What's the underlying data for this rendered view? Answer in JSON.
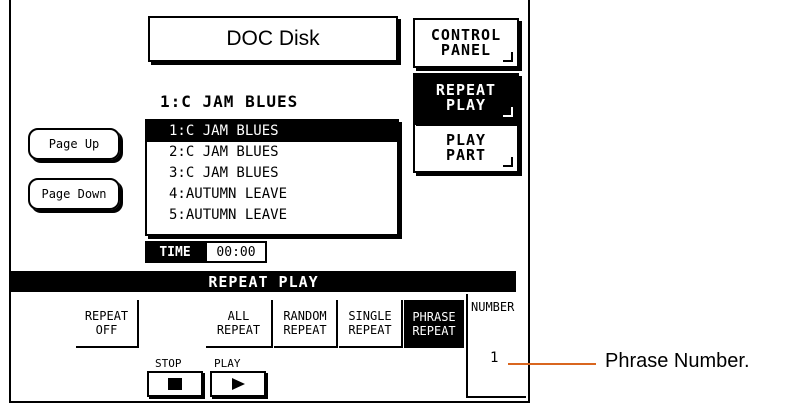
{
  "screen_title": "DOC Disk",
  "side_buttons": [
    {
      "line1": "CONTROL",
      "line2": "PANEL"
    },
    {
      "line1": "REPEAT",
      "line2": "PLAY"
    },
    {
      "line1": "PLAY",
      "line2": "PART"
    }
  ],
  "current_song": "1:C JAM BLUES",
  "song_list": [
    "1:C JAM BLUES",
    "2:C JAM BLUES",
    "3:C JAM BLUES",
    "4:AUTUMN LEAVE",
    "5:AUTUMN LEAVE"
  ],
  "page_up_label": "Page Up",
  "page_down_label": "Page Down",
  "time": {
    "label": "TIME",
    "value": "00:00"
  },
  "section_title": "REPEAT PLAY",
  "repeat_modes": [
    {
      "line1": "REPEAT",
      "line2": "OFF"
    },
    {
      "line1": "ALL",
      "line2": "REPEAT"
    },
    {
      "line1": "RANDOM",
      "line2": "REPEAT"
    },
    {
      "line1": "SINGLE",
      "line2": "REPEAT"
    },
    {
      "line1": "PHRASE",
      "line2": "REPEAT"
    }
  ],
  "number": {
    "label": "NUMBER",
    "value": "1"
  },
  "transport": {
    "stop_label": "STOP",
    "play_label": "PLAY"
  },
  "callout": "Phrase Number.",
  "colors": {
    "callout_line": "#d9661f"
  }
}
